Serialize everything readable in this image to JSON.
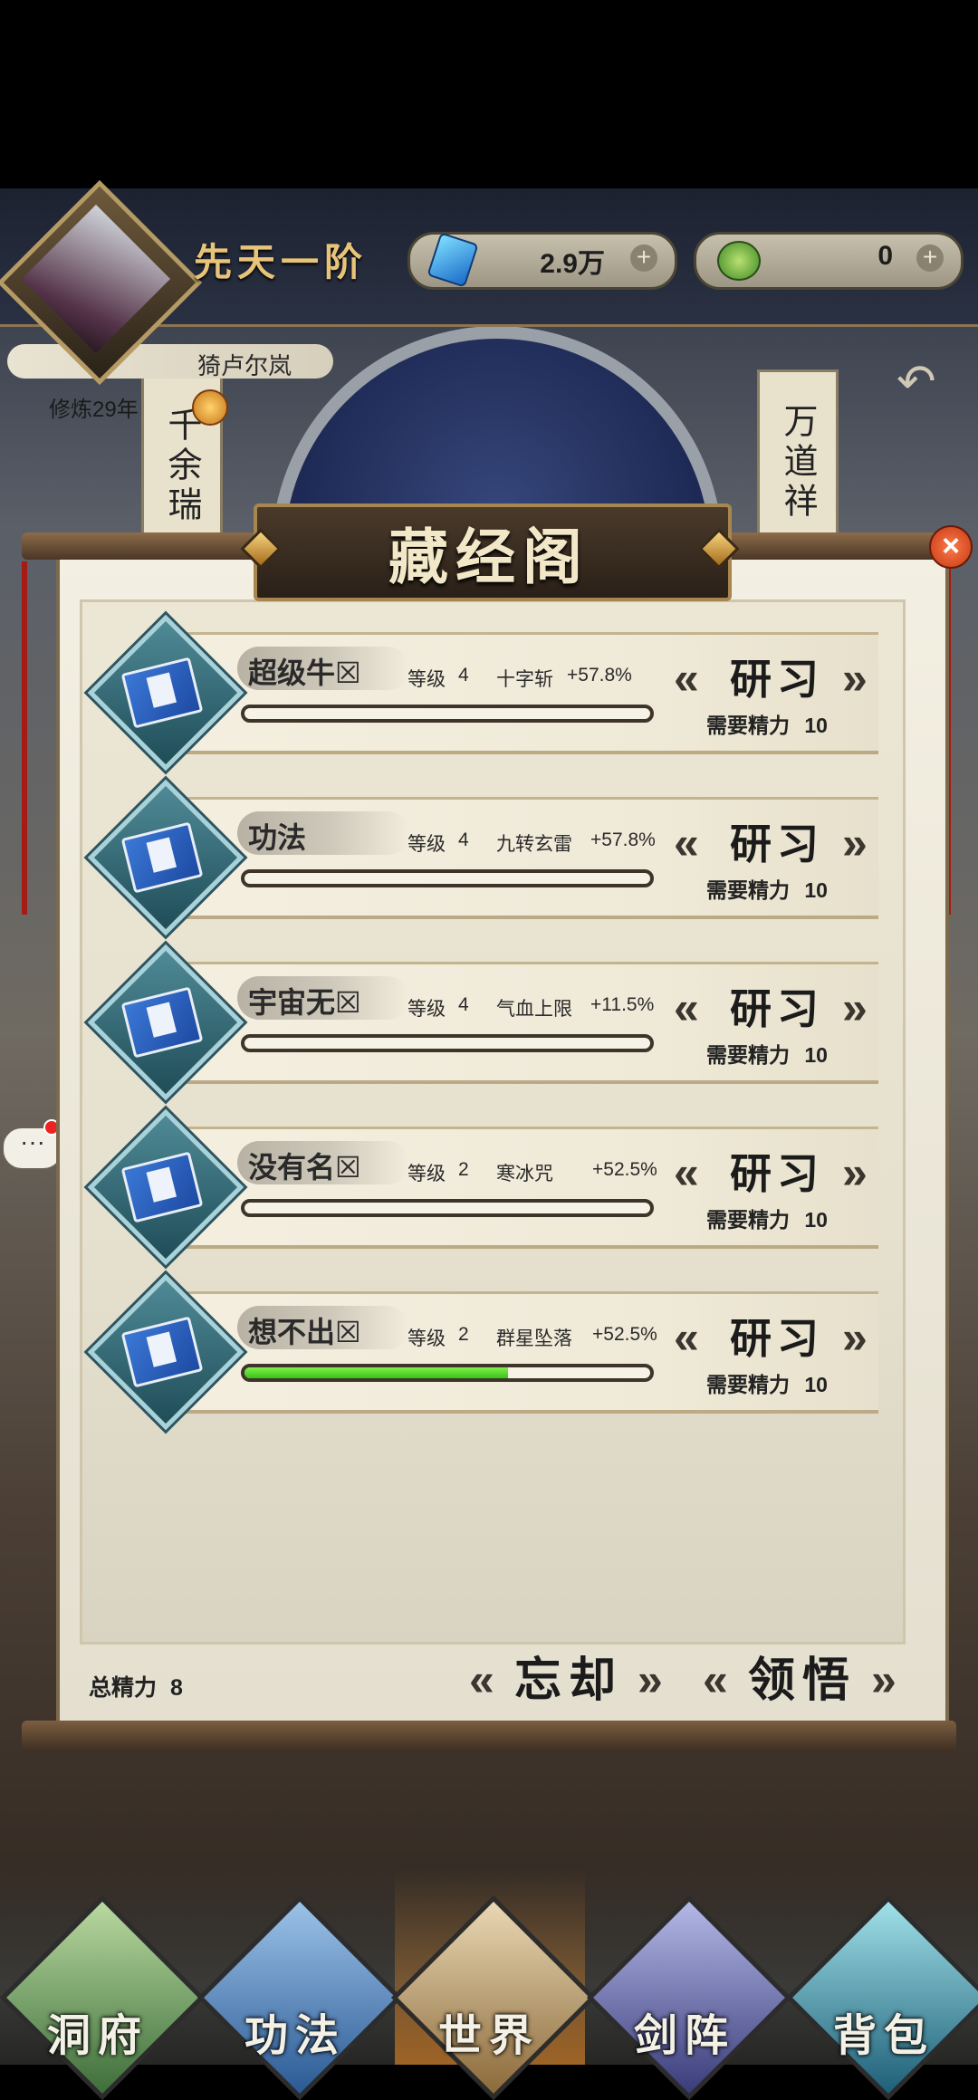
{
  "header": {
    "realm": "先天一阶",
    "player_name": "猗卢尔岚",
    "cultivation": "修炼29年",
    "resources": [
      {
        "icon": "crystal-icon",
        "value": "2.9万"
      },
      {
        "icon": "jade-icon",
        "value": "0"
      }
    ]
  },
  "scene": {
    "left_scroll": "千余瑞",
    "right_scroll": "万道祥"
  },
  "panel": {
    "title": "藏经阁",
    "close": "×",
    "total_energy_label": "总精力",
    "total_energy_value": "8",
    "forget_button": "忘却",
    "comprehend_button": "领悟"
  },
  "skills": [
    {
      "name": "超级牛☒",
      "level_label": "等级",
      "level": "4",
      "effect": "十字斩",
      "bonus": "+57.8%",
      "progress": 0,
      "button": "研习",
      "cost_label": "需要精力",
      "cost": "10"
    },
    {
      "name": "功法",
      "level_label": "等级",
      "level": "4",
      "effect": "九转玄雷",
      "bonus": "+57.8%",
      "progress": 0,
      "button": "研习",
      "cost_label": "需要精力",
      "cost": "10"
    },
    {
      "name": "宇宙无☒",
      "level_label": "等级",
      "level": "4",
      "effect": "气血上限",
      "bonus": "+11.5%",
      "progress": 0,
      "button": "研习",
      "cost_label": "需要精力",
      "cost": "10"
    },
    {
      "name": "没有名☒",
      "level_label": "等级",
      "level": "2",
      "effect": "寒冰咒",
      "bonus": "+52.5%",
      "progress": 0,
      "button": "研习",
      "cost_label": "需要精力",
      "cost": "10"
    },
    {
      "name": "想不出☒",
      "level_label": "等级",
      "level": "2",
      "effect": "群星坠落",
      "bonus": "+52.5%",
      "progress": 0.65,
      "button": "研习",
      "cost_label": "需要精力",
      "cost": "10"
    }
  ],
  "chat": {
    "label": "···"
  },
  "nav": [
    {
      "label": "洞府",
      "active": false
    },
    {
      "label": "功法",
      "active": false
    },
    {
      "label": "世界",
      "active": true
    },
    {
      "label": "剑阵",
      "active": false
    },
    {
      "label": "背包",
      "active": false
    }
  ]
}
